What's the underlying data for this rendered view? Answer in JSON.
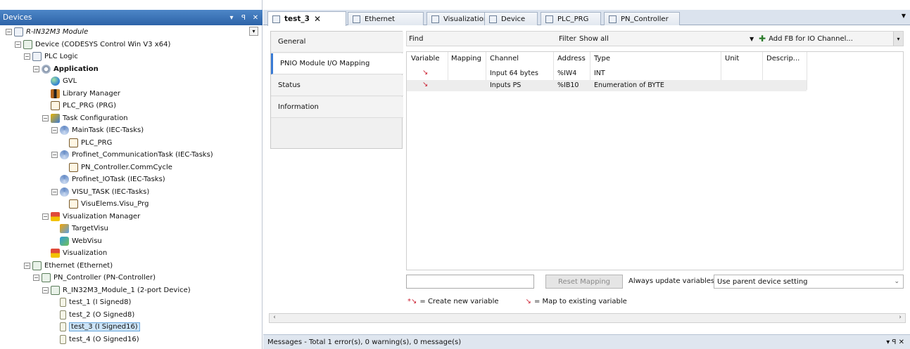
{
  "devices_panel": {
    "title": "Devices",
    "header_controls": [
      "▾",
      "ꟼ",
      "✕"
    ]
  },
  "tree": [
    {
      "label": "R-IN32M3 Module",
      "indent": 0,
      "icon": "doc-icon",
      "exp": "-",
      "style": "italic"
    },
    {
      "label": "Device (CODESYS Control Win V3 x64)",
      "indent": 1,
      "icon": "device-icon",
      "exp": "-"
    },
    {
      "label": "PLC Logic",
      "indent": 2,
      "icon": "plc-logic-icon",
      "exp": "-"
    },
    {
      "label": "Application",
      "indent": 3,
      "icon": "gear-icon",
      "exp": "-",
      "style": "bold"
    },
    {
      "label": "GVL",
      "indent": 4,
      "icon": "globe-icon"
    },
    {
      "label": "Library Manager",
      "indent": 4,
      "icon": "library-icon"
    },
    {
      "label": "PLC_PRG (PRG)",
      "indent": 4,
      "icon": "program-icon"
    },
    {
      "label": "Task Configuration",
      "indent": 4,
      "icon": "task-config-icon",
      "exp": "-"
    },
    {
      "label": "MainTask (IEC-Tasks)",
      "indent": 5,
      "icon": "task-icon",
      "exp": "-"
    },
    {
      "label": "PLC_PRG",
      "indent": 6,
      "icon": "program-icon"
    },
    {
      "label": "Profinet_CommunicationTask (IEC-Tasks)",
      "indent": 5,
      "icon": "task-icon",
      "exp": "-"
    },
    {
      "label": "PN_Controller.CommCycle",
      "indent": 6,
      "icon": "program-icon"
    },
    {
      "label": "Profinet_IOTask (IEC-Tasks)",
      "indent": 5,
      "icon": "task-icon"
    },
    {
      "label": "VISU_TASK (IEC-Tasks)",
      "indent": 5,
      "icon": "task-icon",
      "exp": "-"
    },
    {
      "label": "VisuElems.Visu_Prg",
      "indent": 6,
      "icon": "program-icon"
    },
    {
      "label": "Visualization Manager",
      "indent": 4,
      "icon": "visu-manager-icon",
      "exp": "-"
    },
    {
      "label": "TargetVisu",
      "indent": 5,
      "icon": "target-visu-icon"
    },
    {
      "label": "WebVisu",
      "indent": 5,
      "icon": "web-visu-icon"
    },
    {
      "label": "Visualization",
      "indent": 4,
      "icon": "visualization-icon"
    },
    {
      "label": "Ethernet (Ethernet)",
      "indent": 2,
      "icon": "device-icon",
      "exp": "-"
    },
    {
      "label": "PN_Controller (PN-Controller)",
      "indent": 3,
      "icon": "device-icon",
      "exp": "-"
    },
    {
      "label": "R_IN32M3_Module_1 (2-port Device)",
      "indent": 4,
      "icon": "device-icon",
      "exp": "-"
    },
    {
      "label": "test_1 (I Signed8)",
      "indent": 5,
      "icon": "slot-icon"
    },
    {
      "label": "test_2 (O Signed8)",
      "indent": 5,
      "icon": "slot-icon"
    },
    {
      "label": "test_3 (I Signed16)",
      "indent": 5,
      "icon": "slot-icon",
      "selected": true
    },
    {
      "label": "test_4 (O Signed16)",
      "indent": 5,
      "icon": "slot-icon"
    }
  ],
  "tabs": [
    {
      "label": "test_3",
      "active": true
    },
    {
      "label": "Ethernet"
    },
    {
      "label": "Visualization"
    },
    {
      "label": "Device"
    },
    {
      "label": "PLC_PRG"
    },
    {
      "label": "PN_Controller"
    }
  ],
  "subnav": [
    "General",
    "PNIO Module I/O Mapping",
    "Status",
    "Information"
  ],
  "find_bar": {
    "find_label": "Find",
    "filter_label": "Filter",
    "filter_value": "Show all",
    "add_fb_label": "Add FB for IO Channel..."
  },
  "grid": {
    "columns": [
      "Variable",
      "Mapping",
      "Channel",
      "Address",
      "Type",
      "Unit",
      "Descrip..."
    ],
    "rows": [
      {
        "channel": "Input 64 bytes",
        "address": "%IW4",
        "type": "INT"
      },
      {
        "channel": "Inputs PS",
        "address": "%IB10",
        "type": "Enumeration of BYTE"
      }
    ]
  },
  "controls": {
    "reset_mapping": "Reset Mapping",
    "always_update": "Always update variables",
    "parent_setting": "Use parent device setting"
  },
  "legend": {
    "create": "= Create new variable",
    "map": "= Map to existing variable"
  },
  "messages": {
    "text": "Messages - Total 1 error(s), 0 warning(s), 0 message(s)",
    "controls": "▾ ꟼ ✕"
  }
}
